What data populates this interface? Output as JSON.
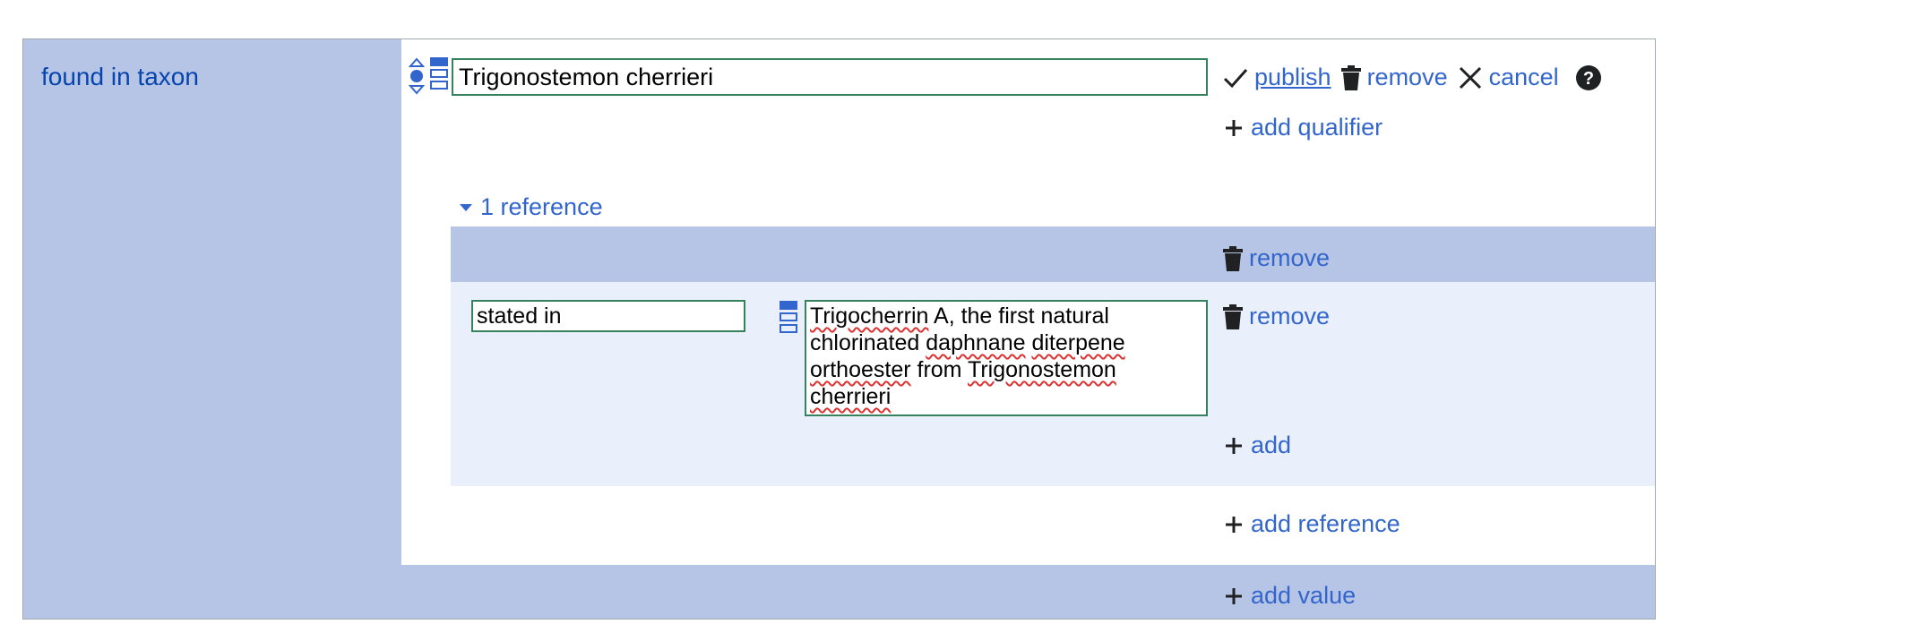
{
  "statement": {
    "property_label": "found in taxon",
    "value": "Trigonostemon cherrieri",
    "toolbar": {
      "publish_label": "publish",
      "remove_label": "remove",
      "cancel_label": "cancel"
    },
    "add_qualifier_label": "add qualifier"
  },
  "references": {
    "toggle_label": "1 reference",
    "header_remove_label": "remove",
    "snak": {
      "property": "stated in",
      "value_words": [
        "Trigocherrin",
        " A, the first natural",
        "chlorinated",
        " ",
        "daphnane",
        " ",
        "diterpene",
        "orthoester",
        " from ",
        "Trigonostemon",
        "cherrieri"
      ],
      "remove_label": "remove"
    },
    "add_label": "add",
    "add_reference_label": "add reference"
  },
  "add_value_label": "add value",
  "icons": {
    "rank": "rank-selector-icon",
    "snaktype": "snaktype-selector-icon",
    "check": "check-icon",
    "trash": "trash-icon",
    "cancel": "close-icon",
    "help": "help-icon",
    "add": "plus-icon",
    "triangle": "triangle-down-icon"
  },
  "colors": {
    "link": "#3366cc",
    "band": "#b6c4e6",
    "ref_body": "#eaf0fb",
    "input_border": "#36815e"
  }
}
